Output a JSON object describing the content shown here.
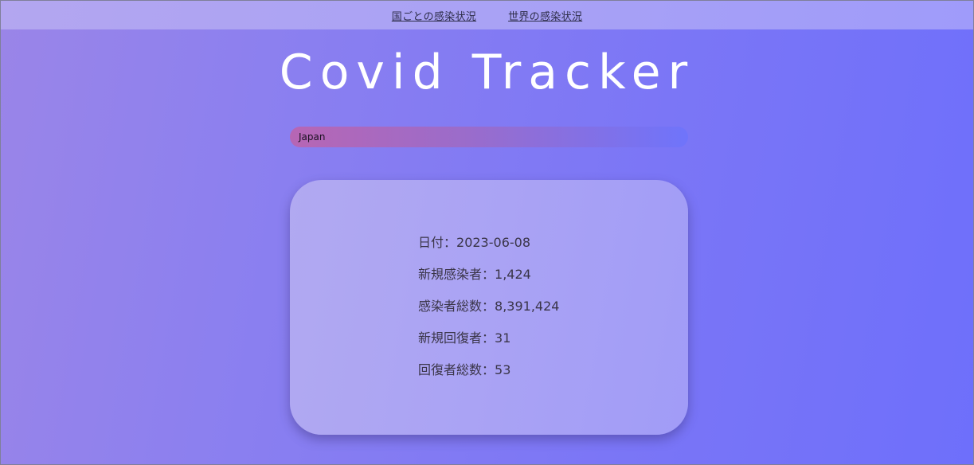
{
  "nav": {
    "links": [
      "国ごとの感染状況",
      "世界の感染状況"
    ]
  },
  "header": {
    "title": "Covid Tracker"
  },
  "country_select": {
    "value": "Japan"
  },
  "stats": {
    "date_label": "日付：",
    "date_value": "2023-06-08",
    "new_cases_label": "新規感染者：",
    "new_cases_value": "1,424",
    "total_cases_label": "感染者総数：",
    "total_cases_value": "8,391,424",
    "new_recovered_label": "新規回復者：",
    "new_recovered_value": "31",
    "total_recovered_label": "回復者総数：",
    "total_recovered_value": "53"
  },
  "colors": {
    "title": "#ffffff",
    "text": "#3a3548",
    "select_start": "#b766b4",
    "select_end": "#6f74fb"
  }
}
